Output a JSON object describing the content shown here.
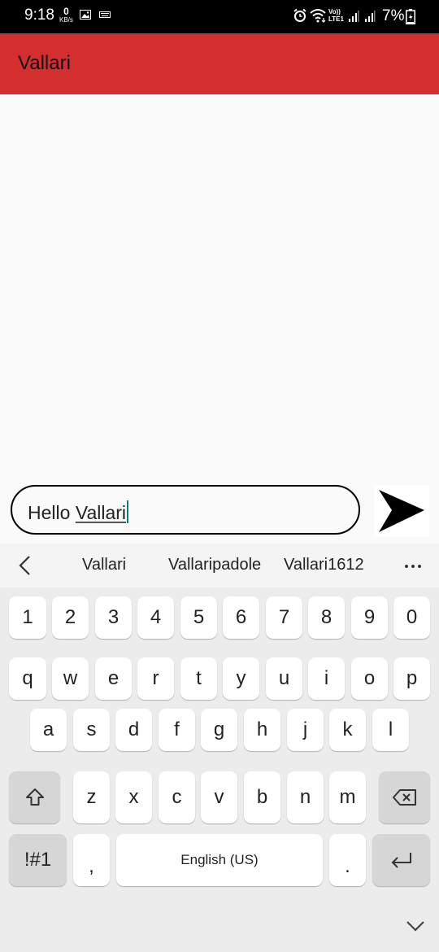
{
  "status_bar": {
    "time": "9:18",
    "net_speed_value": "0",
    "net_speed_unit": "KB/s",
    "network_label_top": "Vo))",
    "network_label_bottom": "LTE1",
    "battery": "7%"
  },
  "app_bar": {
    "title": "Vallari"
  },
  "composer": {
    "text_word1": "Hello ",
    "text_word2": "Vallari"
  },
  "keyboard": {
    "suggestions": [
      "Vallari",
      "Vallaripadole",
      "Vallari1612"
    ],
    "row_numbers": [
      "1",
      "2",
      "3",
      "4",
      "5",
      "6",
      "7",
      "8",
      "9",
      "0"
    ],
    "row_1": [
      "q",
      "w",
      "e",
      "r",
      "t",
      "y",
      "u",
      "i",
      "o",
      "p"
    ],
    "row_2": [
      "a",
      "s",
      "d",
      "f",
      "g",
      "h",
      "j",
      "k",
      "l"
    ],
    "row_3": [
      "z",
      "x",
      "c",
      "v",
      "b",
      "n",
      "m"
    ],
    "symbols_label": "!#1",
    "comma": ",",
    "space_label": "English (US)",
    "period": "."
  },
  "icons": [
    "gallery-icon",
    "keyboard-icon",
    "alarm-icon",
    "wifi-icon",
    "signal-icon",
    "battery-icon",
    "send-icon",
    "back-chevron-icon",
    "more-icon",
    "shift-icon",
    "backspace-icon",
    "enter-icon",
    "chevron-down-icon"
  ],
  "colors": {
    "app_bar": "#d32f2f",
    "status_bar": "#000000",
    "caret": "#0a7e7e",
    "keyboard_bg": "#ececec"
  }
}
